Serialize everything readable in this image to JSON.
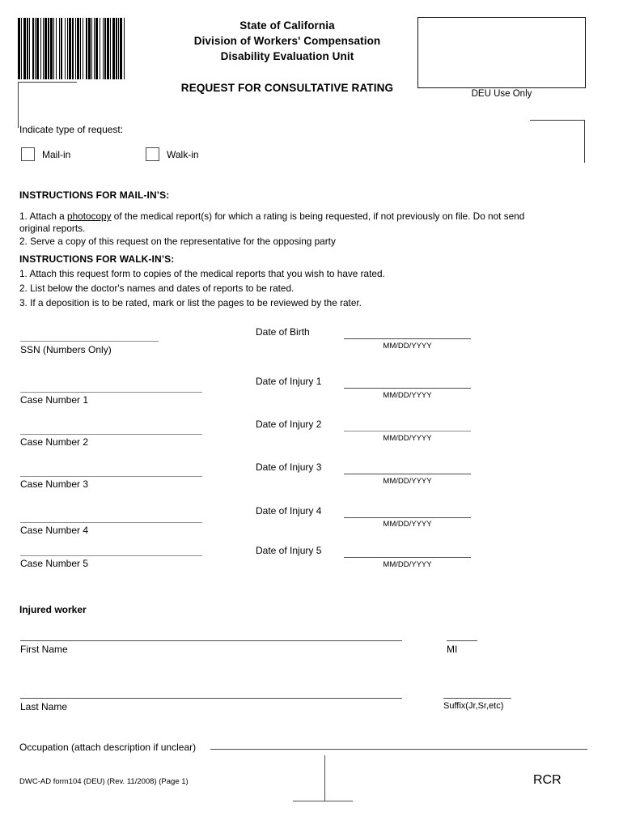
{
  "header": {
    "agency_line1": "State of California",
    "agency_line2": "Division of Workers' Compensation",
    "agency_line3": "Disability Evaluation Unit",
    "form_title": "REQUEST FOR CONSULTATIVE RATING",
    "deu_box_caption": "DEU Use Only",
    "barcode_name": "barcode"
  },
  "request_type": {
    "prompt": "Indicate type of request:",
    "options": [
      {
        "label": "Mail-in",
        "checked": false
      },
      {
        "label": "Walk-in",
        "checked": false
      }
    ]
  },
  "instructions": {
    "mail_heading": "INSTRUCTIONS FOR MAIL-IN’S:",
    "mail_items": [
      "1. Attach a photocopy  of the medical report(s) for which a rating is being requested, if not previously on file. Do not send original reports.",
      "2. Serve a copy of this request on the representative for the opposing party"
    ],
    "mail_item_1_pre": "1. Attach a ",
    "mail_item_1_underlined": "photocopy",
    "mail_item_1_post": "  of the medical report(s) for which a rating is being requested, if not previously on file. Do not send original reports.",
    "walk_heading": "INSTRUCTIONS FOR WALK-IN’S:",
    "walk_items": [
      "1. Attach this request form to copies of the medical reports that you wish to have rated.",
      "2. List below the doctor's names and dates of reports to be rated.",
      "3. If a deposition is to be rated, mark or list the pages to be reviewed by the rater."
    ]
  },
  "identifiers": {
    "ssn_label": "SSN (Numbers Only)",
    "ssn_value": "",
    "case_numbers": [
      {
        "label": "Case Number 1",
        "value": ""
      },
      {
        "label": "Case Number 2",
        "value": ""
      },
      {
        "label": "Case Number 3",
        "value": ""
      },
      {
        "label": "Case Number 4",
        "value": ""
      },
      {
        "label": "Case Number 5",
        "value": ""
      }
    ]
  },
  "dates": {
    "hint": "MM/DD/YYYY",
    "entries": [
      {
        "label": "Date of Birth",
        "value": "",
        "hint": "MM/DD/YYYY"
      },
      {
        "label": "Date of Injury 1",
        "value": "",
        "hint": "MM/DD/YYYY"
      },
      {
        "label": "Date of Injury 2",
        "value": "",
        "hint": "MM/DD/YYYY"
      },
      {
        "label": "Date of Injury 3",
        "value": "",
        "hint": "MM/DD/YYYY"
      },
      {
        "label": "Date of Injury 4",
        "value": "",
        "hint": "MM/DD/YYYY"
      },
      {
        "label": "Date of Injury 5",
        "value": "",
        "hint": "MM/DD/YYYY"
      }
    ]
  },
  "injured_worker": {
    "heading": "Injured worker",
    "first_name_label": "First Name",
    "first_name_value": "",
    "mi_label": "MI",
    "mi_value": "",
    "last_name_label": "Last Name",
    "last_name_value": "",
    "suffix_label": "Suffix(Jr,Sr,etc)",
    "suffix_value": ""
  },
  "footer": {
    "occupation_label": "Occupation (attach description if unclear)",
    "occupation_value": "",
    "form_number": "DWC-AD form104 (DEU) (Rev. 11/2008) (Page 1)",
    "code": "RCR"
  },
  "colors": {
    "ink": "#000000",
    "rule": "#4b4b4b",
    "rule_light": "#8d8d8d",
    "box_border": "#111111"
  }
}
